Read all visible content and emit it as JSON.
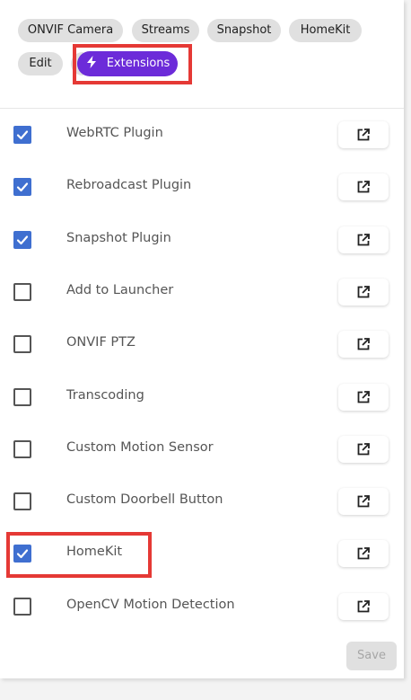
{
  "tabs": [
    {
      "label": "ONVIF Camera",
      "active": false
    },
    {
      "label": "Streams",
      "active": false
    },
    {
      "label": "Snapshot",
      "active": false
    },
    {
      "label": "HomeKit",
      "active": false
    },
    {
      "label": "Edit",
      "active": false
    },
    {
      "label": "Extensions",
      "active": true,
      "icon": "bolt-icon"
    }
  ],
  "extensions": [
    {
      "label": "WebRTC Plugin",
      "checked": true
    },
    {
      "label": "Rebroadcast Plugin",
      "checked": true
    },
    {
      "label": "Snapshot Plugin",
      "checked": true
    },
    {
      "label": "Add to Launcher",
      "checked": false
    },
    {
      "label": "ONVIF PTZ",
      "checked": false
    },
    {
      "label": "Transcoding",
      "checked": false
    },
    {
      "label": "Custom Motion Sensor",
      "checked": false
    },
    {
      "label": "Custom Doorbell Button",
      "checked": false
    },
    {
      "label": "HomeKit",
      "checked": true
    },
    {
      "label": "OpenCV Motion Detection",
      "checked": false
    }
  ],
  "actions": {
    "save_label": "Save",
    "save_enabled": false
  },
  "colors": {
    "accent": "#6c2bd9",
    "checkbox": "#3f6fd0",
    "annotation": "#e53935",
    "chip": "#e0e0e0"
  }
}
